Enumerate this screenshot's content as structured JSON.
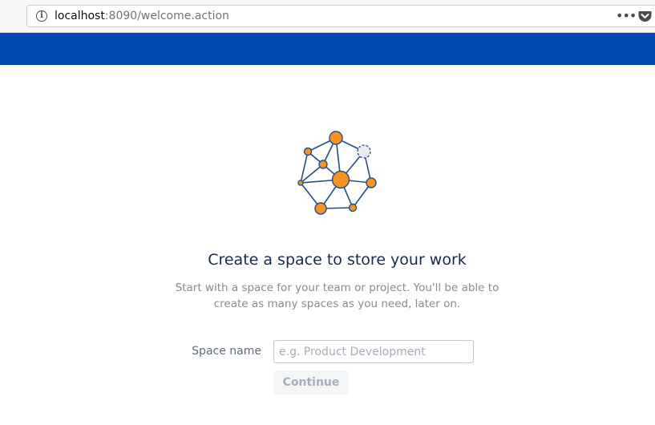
{
  "browser": {
    "url_host": "localhost",
    "url_rest": ":8090/welcome.action",
    "info_icon": "info-icon",
    "more_icon": "more-icon",
    "pocket_icon": "pocket-icon"
  },
  "header": {
    "color": "#0049b0"
  },
  "welcome": {
    "illustration": "network-graph-illustration",
    "title": "Create a space to store your work",
    "subtitle": "Start with a space for your team or project. You'll be able to create as many spaces as you need, later on."
  },
  "form": {
    "label": "Space name",
    "placeholder": "e.g. Product Development",
    "value": "",
    "continue_label": "Continue"
  },
  "colors": {
    "node_orange": "#f7931e",
    "edge_blue": "#1f4e8c",
    "title_text": "#172b4d"
  }
}
